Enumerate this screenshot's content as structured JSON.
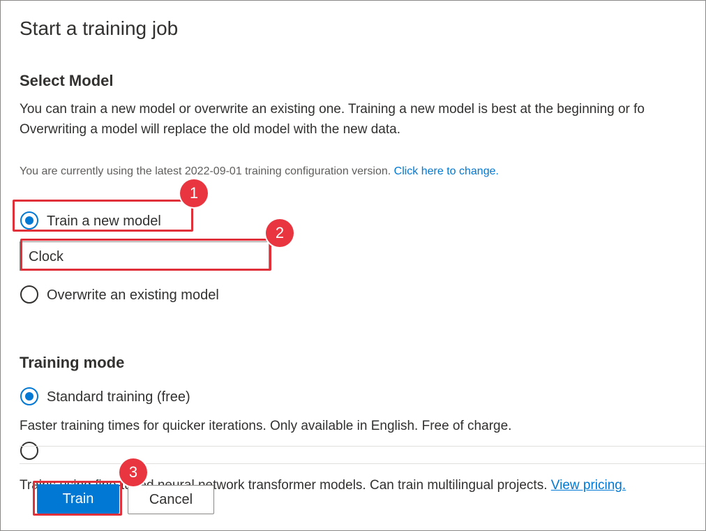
{
  "panel": {
    "title": "Start a training job"
  },
  "select_model": {
    "heading": "Select Model",
    "description_line1": "You can train a new model or overwrite an existing one. Training a new model is best at the beginning or fo",
    "description_line2": "Overwriting a model will replace the old model with the new data.",
    "config_text": "You are currently using the latest 2022-09-01 training configuration version.",
    "config_link": "Click here to change.",
    "options": [
      {
        "label": "Train a new model",
        "checked": true
      },
      {
        "label": "Overwrite an existing model",
        "checked": false
      }
    ],
    "model_name_value": "Clock"
  },
  "training_mode": {
    "heading": "Training mode",
    "options": [
      {
        "label": "Standard training (free)",
        "checked": true
      }
    ],
    "standard_description": "Faster training times for quicker iterations. Only available in English. Free of charge.",
    "advanced_description": "Trains using fine-tuned neural network transformer models. Can train multilingual projects.",
    "pricing_link": "View pricing."
  },
  "footer": {
    "train_label": "Train",
    "cancel_label": "Cancel"
  },
  "annotations": {
    "badge1": "1",
    "badge2": "2",
    "badge3": "3",
    "highlight_color": "#e0313a"
  },
  "colors": {
    "accent": "#0078d4",
    "text": "#323130"
  }
}
